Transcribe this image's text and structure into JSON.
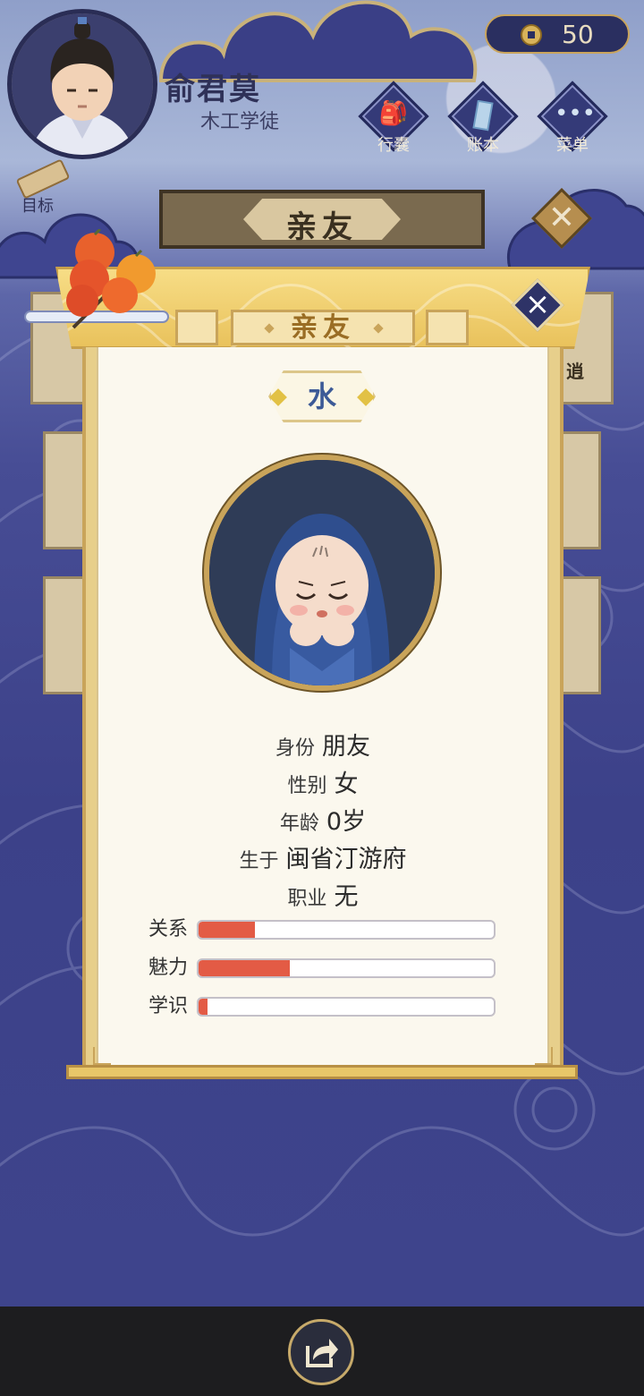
{
  "player": {
    "name": "俞君莫",
    "title": "木工学徒"
  },
  "currency": {
    "icon": "copper-coin-icon",
    "value": "50"
  },
  "top_menu": [
    {
      "label": "行囊",
      "icon": "bag-icon"
    },
    {
      "label": "账本",
      "icon": "ledger-icon"
    },
    {
      "label": "菜单",
      "icon": "more-icon"
    }
  ],
  "goal": {
    "label": "目标",
    "icon": "scroll-icon"
  },
  "background_tab": {
    "title": "亲友"
  },
  "background_text_fragment": "逍",
  "modal": {
    "title": "亲友",
    "character_name": "水",
    "portrait_icon": "hooded-child-portrait",
    "info": {
      "identity": {
        "label": "身份",
        "value": "朋友"
      },
      "gender": {
        "label": "性别",
        "value": "女"
      },
      "age": {
        "label": "年龄",
        "value": "0岁"
      },
      "birthplace": {
        "label": "生于",
        "value": "闽省汀游府"
      },
      "occupation": {
        "label": "职业",
        "value": "无"
      }
    },
    "stats": [
      {
        "label": "关系",
        "fraction": 0.19
      },
      {
        "label": "魅力",
        "fraction": 0.31
      },
      {
        "label": "学识",
        "fraction": 0.03
      }
    ]
  },
  "colors": {
    "stat_fill": "#e35b45",
    "name_text": "#3c5a97",
    "gold_border": "#c9a45a",
    "bottom_bar": "#1d1d1f"
  },
  "bottom": {
    "share_icon": "share-icon"
  }
}
